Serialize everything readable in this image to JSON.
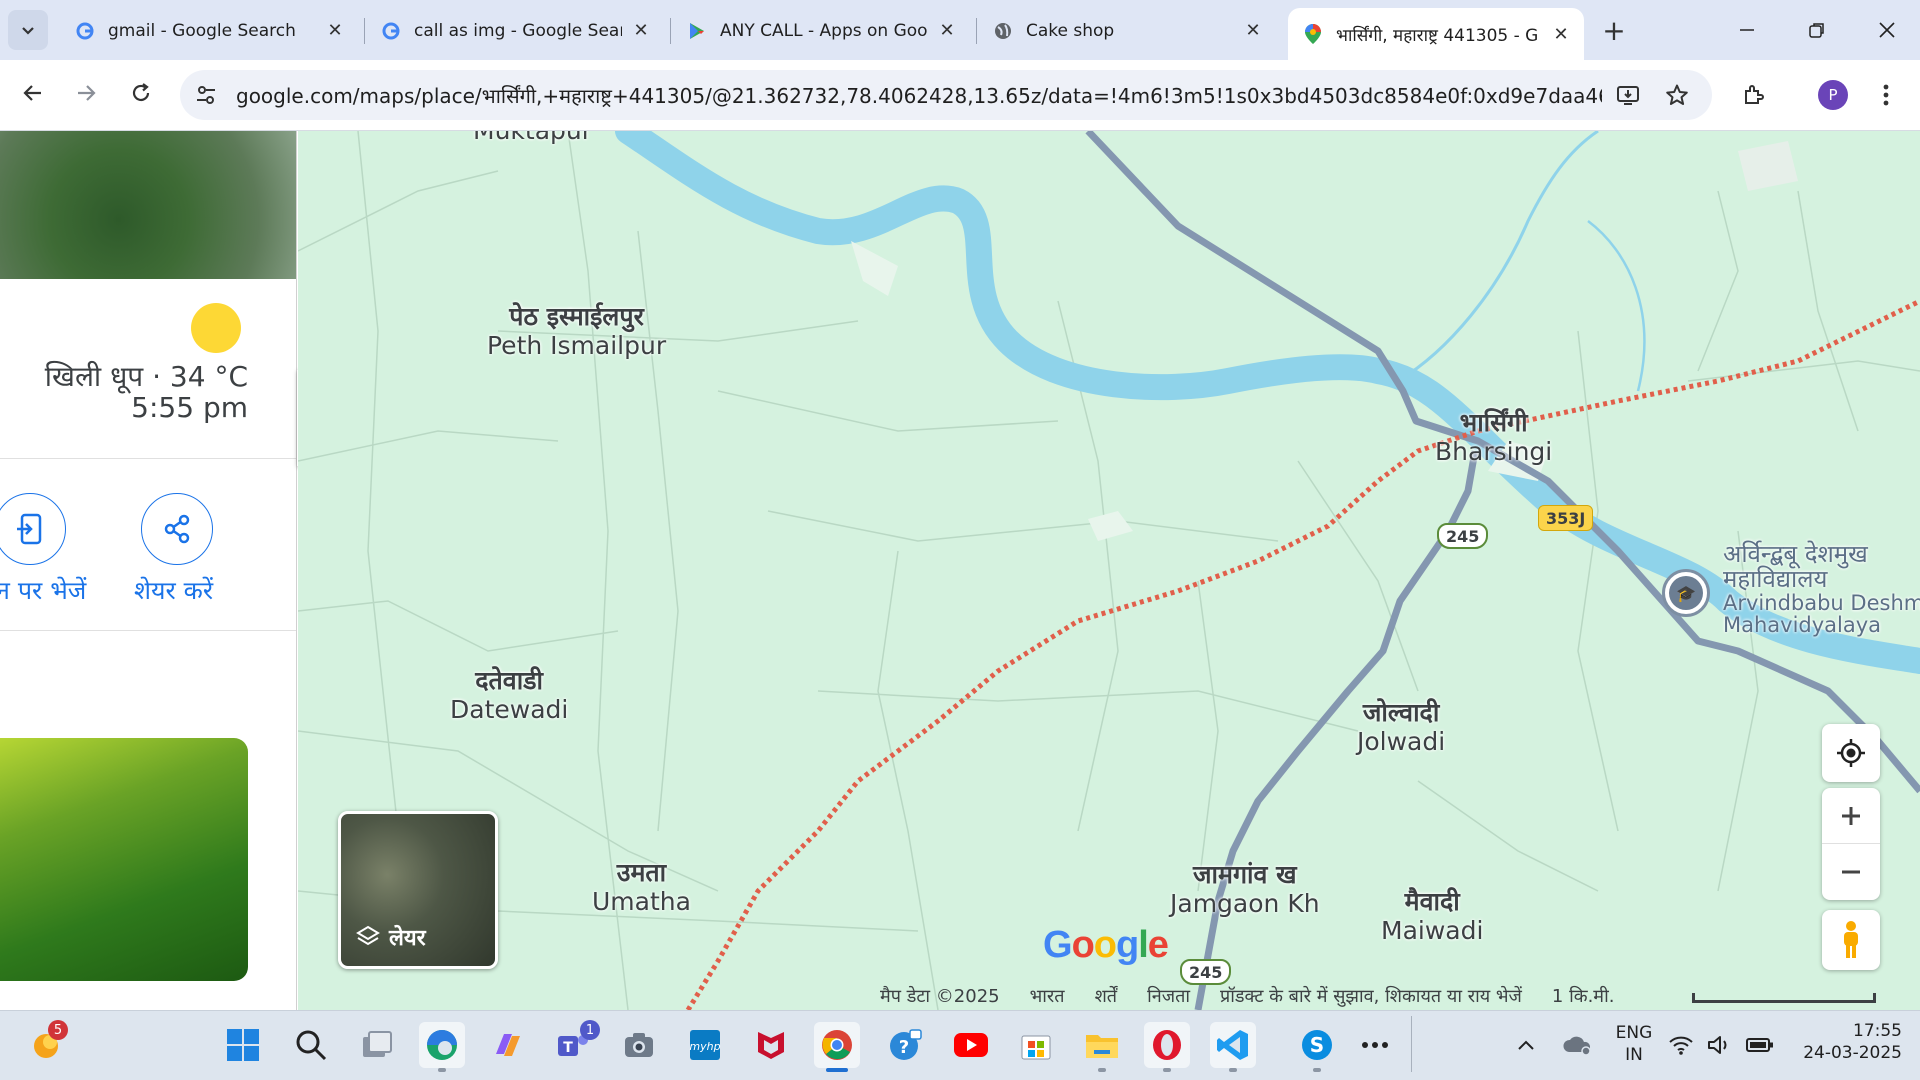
{
  "tabs": [
    {
      "title": "gmail - Google Search",
      "favicon": "google-g-icon",
      "active": false
    },
    {
      "title": "call as img - Google Sear",
      "favicon": "google-g-icon",
      "active": false
    },
    {
      "title": "ANY CALL - Apps on Goo",
      "favicon": "google-play-icon",
      "active": false
    },
    {
      "title": "Cake shop",
      "favicon": "globe-icon",
      "active": false
    },
    {
      "title": "भार्सिंगी, महाराष्ट्र 441305 - G",
      "favicon": "maps-pin-icon",
      "active": true
    }
  ],
  "toolbar": {
    "url": "google.com/maps/place/भार्सिंगी,+महाराष्ट्र+441305/@21.362732,78.4062428,13.65z/data=!4m6!3m5!1s0x3bd4503dc8584e0f:0xd9e7daa46e7df72a!...",
    "profile_initial": "P"
  },
  "sidepanel": {
    "weather": "खिली धूप · 34 °C",
    "time": "5:55 pm",
    "send_label": "न पर भेजें",
    "share_label": "शेयर करें"
  },
  "map": {
    "places": [
      {
        "hi": "",
        "en": "Muktapur"
      },
      {
        "hi": "पेठ इस्माईलपुर",
        "en": "Peth Ismailpur"
      },
      {
        "hi": "भार्सिंगी",
        "en": "Bharsingi"
      },
      {
        "hi": "दतेवाडी",
        "en": "Datewadi"
      },
      {
        "hi": "जोल्वादी",
        "en": "Jolwadi"
      },
      {
        "hi": "उमता",
        "en": "Umatha"
      },
      {
        "hi": "जामगांव ख",
        "en": "Jamgaon Kh"
      },
      {
        "hi": "मैवादी",
        "en": "Maiwadi"
      }
    ],
    "college": {
      "hi1": "अर्विन्द्बबू देशमुख",
      "hi2": "महाविद्यालय",
      "en1": "Arvindbabu Deshmu",
      "en2": "Mahavidyalaya"
    },
    "road_shields": {
      "r1": "245",
      "r2": "353J",
      "r3": "245"
    },
    "layer_label": "लेयर",
    "google_logo": "Google",
    "attribution": [
      "मैप डेटा ©2025",
      "भारत",
      "शर्तें",
      "निजता",
      "प्रॉडक्ट के बारे में सुझाव, शिकायत या राय भेजें",
      "1 कि.मी."
    ]
  },
  "taskbar": {
    "weather_badge": "5",
    "teams_badge": "1",
    "lang": "ENG",
    "region": "IN",
    "time": "17:55",
    "date": "24-03-2025"
  },
  "colors": {
    "tabstrip": "#dfe6f5",
    "map_land": "#d5f2df",
    "river": "#8fd3ea",
    "road": "#8497b0",
    "border_line": "#e15f4b",
    "link_blue": "#1a73e8"
  }
}
